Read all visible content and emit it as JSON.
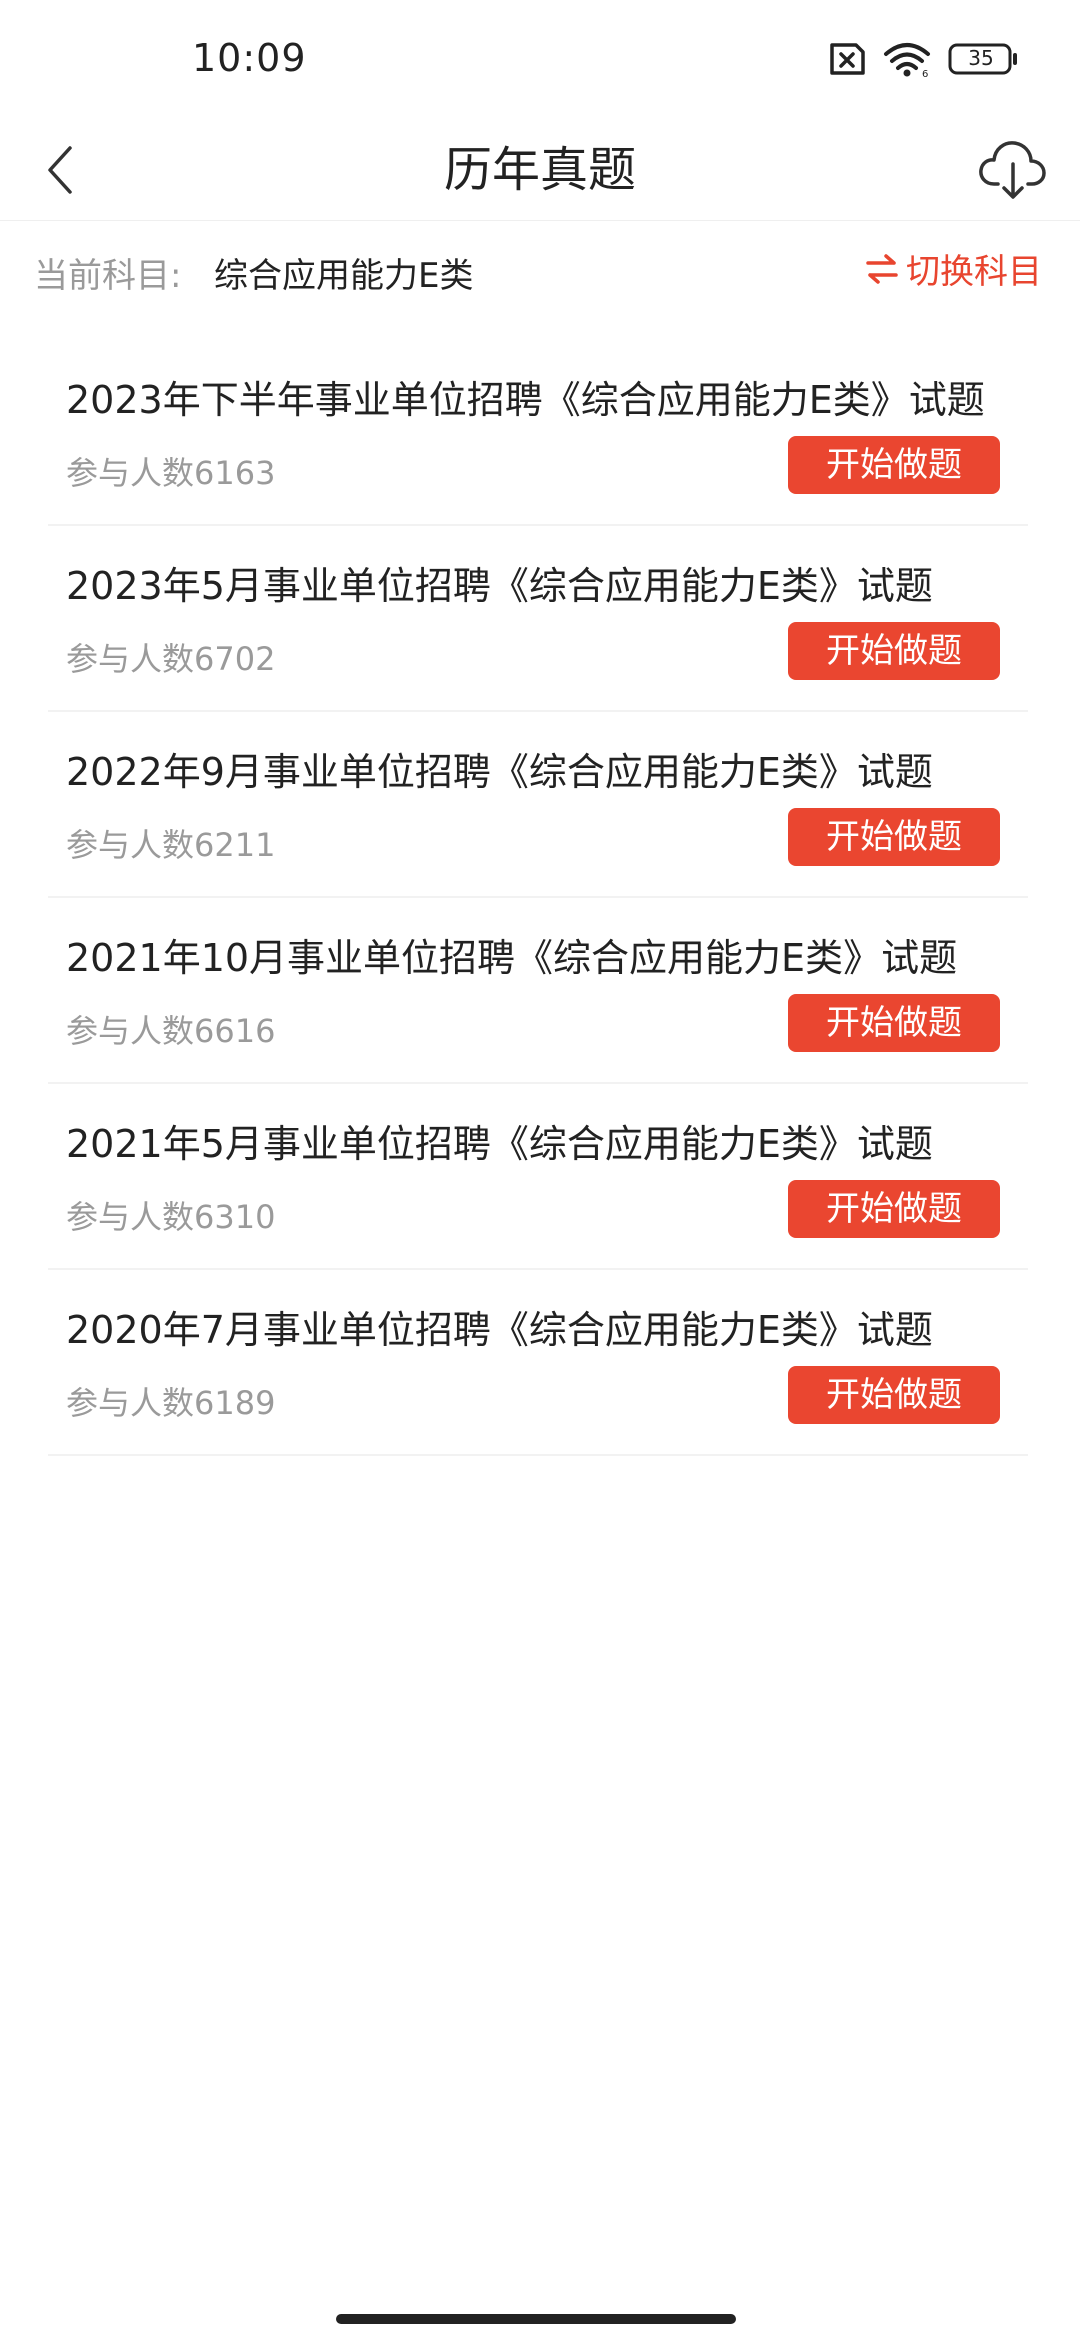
{
  "status_bar": {
    "time": "10:09",
    "battery": "35",
    "icons": [
      "sim-error-icon",
      "wifi-icon",
      "battery-icon"
    ]
  },
  "nav": {
    "title": "历年真题",
    "back_icon": "chevron-left-icon",
    "download_icon": "cloud-download-icon"
  },
  "subject": {
    "label": "当前科目:",
    "value": "综合应用能力E类",
    "switch_label": "切换科目",
    "switch_icon": "swap-arrows-icon"
  },
  "exams": [
    {
      "title": "2023年下半年事业单位招聘《综合应用能力E类》试题",
      "participants": "参与人数6163",
      "button": "开始做题"
    },
    {
      "title": "2023年5月事业单位招聘《综合应用能力E类》试题",
      "participants": "参与人数6702",
      "button": "开始做题"
    },
    {
      "title": "2022年9月事业单位招聘《综合应用能力E类》试题",
      "participants": "参与人数6211",
      "button": "开始做题"
    },
    {
      "title": "2021年10月事业单位招聘《综合应用能力E类》试题",
      "participants": "参与人数6616",
      "button": "开始做题"
    },
    {
      "title": "2021年5月事业单位招聘《综合应用能力E类》试题",
      "participants": "参与人数6310",
      "button": "开始做题"
    },
    {
      "title": "2020年7月事业单位招聘《综合应用能力E类》试题",
      "participants": "参与人数6189",
      "button": "开始做题"
    }
  ],
  "colors": {
    "accent": "#ea4630",
    "switch_text": "#e8452f",
    "muted_text": "#9a9a9a",
    "primary_text": "#222222"
  }
}
